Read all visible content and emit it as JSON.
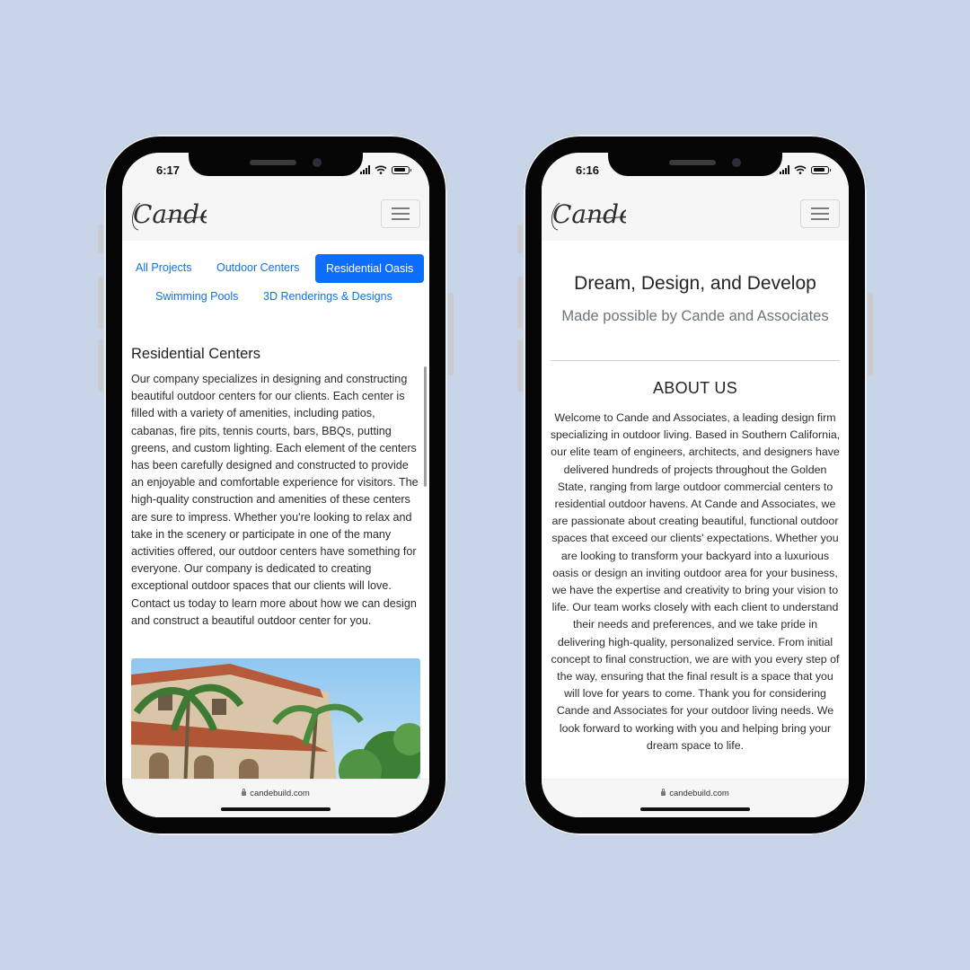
{
  "url": "candebuild.com",
  "logo_text": "Cande",
  "left_phone": {
    "time": "6:17",
    "tabs": [
      {
        "label": "All Projects",
        "active": false
      },
      {
        "label": "Outdoor Centers",
        "active": false
      },
      {
        "label": "Residential Oasis",
        "active": true
      },
      {
        "label": "Swimming Pools",
        "active": false
      },
      {
        "label": "3D Renderings & Designs",
        "active": false
      }
    ],
    "section_title": "Residential Centers",
    "section_body": "Our company specializes in designing and constructing beautiful outdoor centers for our clients. Each center is filled with a variety of amenities, including patios, cabanas, fire pits, tennis courts, bars, BBQs, putting greens, and custom lighting. Each element of the centers has been carefully designed and constructed to provide an enjoyable and comfortable experience for visitors. The high-quality construction and amenities of these centers are sure to impress. Whether you're looking to relax and take in the scenery or participate in one of the many activities offered, our outdoor centers have something for everyone. Our company is dedicated to creating exceptional outdoor spaces that our clients will love. Contact us today to learn more about how we can design and construct a beautiful outdoor center for you."
  },
  "right_phone": {
    "time": "6:16",
    "hero_title": "Dream, Design, and Develop",
    "hero_subtitle": "Made possible by Cande and Associates",
    "about_title": "ABOUT US",
    "about_body": "Welcome to Cande and Associates, a leading design firm specializing in outdoor living. Based in Southern California, our elite team of engineers, architects, and designers have delivered hundreds of projects throughout the Golden State, ranging from large outdoor commercial centers to residential outdoor havens. At Cande and Associates, we are passionate about creating beautiful, functional outdoor spaces that exceed our clients' expectations. Whether you are looking to transform your backyard into a luxurious oasis or design an inviting outdoor area for your business, we have the expertise and creativity to bring your vision to life. Our team works closely with each client to understand their needs and preferences, and we take pride in delivering high-quality, personalized service. From initial concept to final construction, we are with you every step of the way, ensuring that the final result is a space that you will love for years to come. Thank you for considering Cande and Associates for your outdoor living needs. We look forward to working with you and helping bring your dream space to life."
  },
  "colors": {
    "background": "#c8d5e9",
    "link": "#0d6efd",
    "navbar": "#f5f6f5",
    "phone_frame": "#050505"
  }
}
